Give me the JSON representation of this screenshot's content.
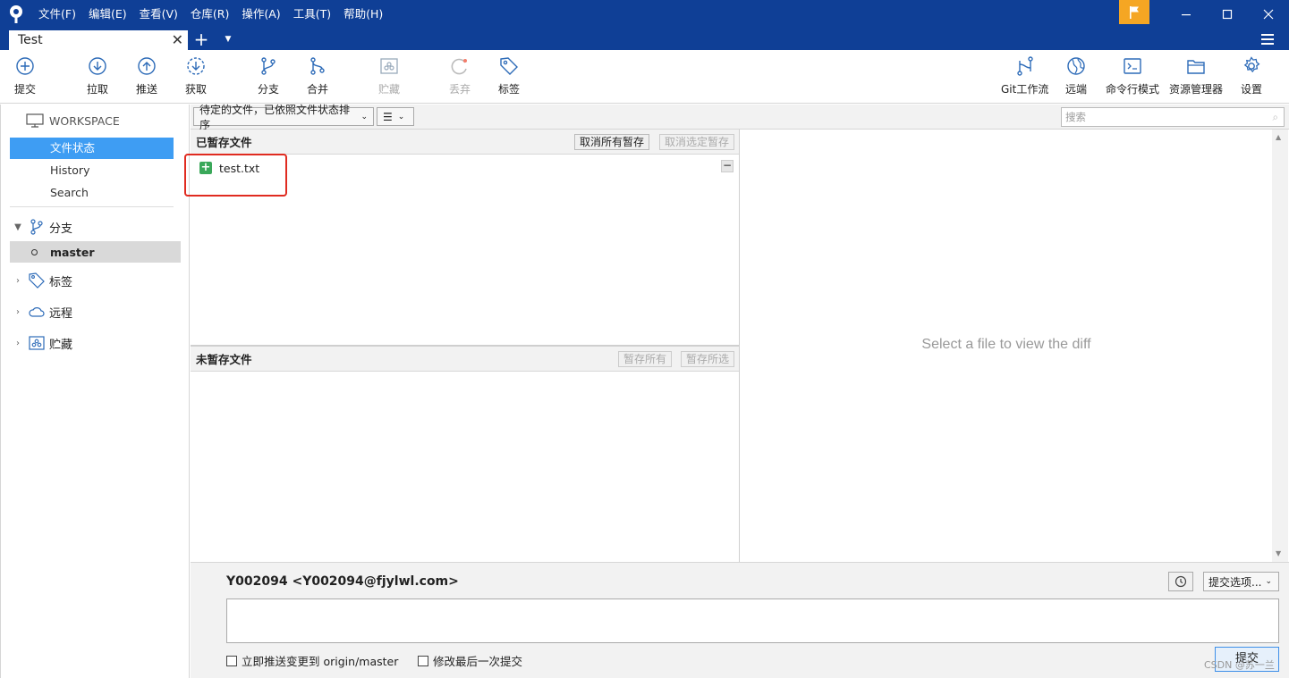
{
  "titlebar": {
    "menus": [
      "文件(F)",
      "编辑(E)",
      "查看(V)",
      "仓库(R)",
      "操作(A)",
      "工具(T)",
      "帮助(H)"
    ],
    "accent": "#0f3f96",
    "flag_color": "#f5a623"
  },
  "tabs": {
    "active": "Test"
  },
  "toolbar": {
    "commit": "提交",
    "pull": "拉取",
    "push": "推送",
    "fetch": "获取",
    "branch": "分支",
    "merge": "合并",
    "stash": "贮藏",
    "discard": "丢弃",
    "tag": "标签",
    "gitflow": "Git工作流",
    "remote": "远端",
    "terminal": "命令行模式",
    "explorer": "资源管理器",
    "settings": "设置"
  },
  "sidebar": {
    "workspace": "WORKSPACE",
    "items": [
      "文件状态",
      "History",
      "Search"
    ],
    "branches_label": "分支",
    "current_branch": "master",
    "tags_label": "标签",
    "remotes_label": "远程",
    "stashes_label": "贮藏"
  },
  "filter": {
    "sort_option": "待定的文件，已依照文件状态排序",
    "view_icon": "☰",
    "search_placeholder": "搜索"
  },
  "staged": {
    "title": "已暂存文件",
    "unstage_all": "取消所有暂存",
    "unstage_selected": "取消选定暂存",
    "files": [
      {
        "name": "test.txt",
        "status": "added"
      }
    ]
  },
  "unstaged": {
    "title": "未暂存文件",
    "stage_all": "暂存所有",
    "stage_selected": "暂存所选"
  },
  "diff": {
    "placeholder": "Select a file to view the diff"
  },
  "commit": {
    "author": "Y002094 <Y002094@fjylwl.com>",
    "options": "提交选项...",
    "push_now": "立即推送变更到 origin/master",
    "amend": "修改最后一次提交",
    "submit": "提交"
  },
  "watermark": "CSDN @苏一兰"
}
